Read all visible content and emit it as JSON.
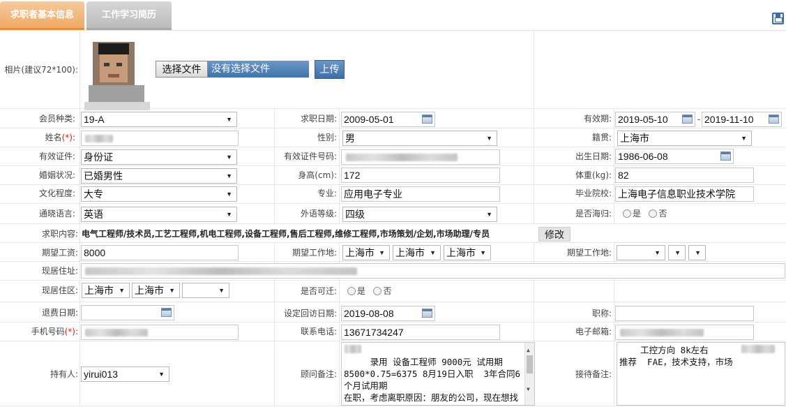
{
  "tabs": [
    {
      "label": "求职者基本信息",
      "active": true
    },
    {
      "label": "工作学习简历",
      "active": false
    }
  ],
  "photo": {
    "label": "相片(建议72*100):",
    "choose_file": "选择文件",
    "no_file": "没有选择文件",
    "upload": "上传"
  },
  "fields": {
    "member_type": {
      "label": "会员种类:",
      "value": "19-A"
    },
    "apply_date": {
      "label": "求职日期:",
      "value": "2009-05-01"
    },
    "valid_period": {
      "label": "有效期:",
      "from": "2019-05-10",
      "sep": "-",
      "to": "2019-11-10"
    },
    "name": {
      "label": "姓名",
      "req": "(*)",
      "colon": ":"
    },
    "gender": {
      "label": "性别:",
      "value": "男"
    },
    "native_place": {
      "label": "籍贯:",
      "value": "上海市"
    },
    "id_type": {
      "label": "有效证件:",
      "value": "身份证"
    },
    "id_number": {
      "label": "有效证件号码:"
    },
    "birth_date": {
      "label": "出生日期:",
      "value": "1986-06-08"
    },
    "marital": {
      "label": "婚姻状况:",
      "value": "已婚男性"
    },
    "height": {
      "label": "身高(cm):",
      "value": "172"
    },
    "weight": {
      "label": "体重(kg):",
      "value": "82"
    },
    "education": {
      "label": "文化程度:",
      "value": "大专"
    },
    "major": {
      "label": "专业:",
      "value": "应用电子专业"
    },
    "school": {
      "label": "毕业院校:",
      "value": "上海电子信息职业技术学院"
    },
    "language": {
      "label": "通晓语言:",
      "value": "英语"
    },
    "language_level": {
      "label": "外语等级:",
      "value": "四级"
    },
    "returnee": {
      "label": "是否海归:",
      "yes": "是",
      "no": "否"
    },
    "job_content": {
      "label": "求职内容:",
      "value": "电气工程师/技术员,工艺工程师,机电工程师,设备工程师,售后工程师,维修工程师,市场策划/企划,市场助理/专员",
      "modify": "修改"
    },
    "expected_salary": {
      "label": "期望工资:",
      "value": "8000"
    },
    "expected_location": {
      "label": "期望工作地:",
      "values": [
        "上海市",
        "上海市",
        "上海市"
      ]
    },
    "expected_location2": {
      "label": "期望工作地:"
    },
    "address": {
      "label": "现居住址:"
    },
    "district": {
      "label": "现居住区:",
      "values": [
        "上海市",
        "上海市",
        ""
      ]
    },
    "relocate": {
      "label": "是否可迁:",
      "yes": "是",
      "no": "否"
    },
    "refund_date": {
      "label": "退费日期:"
    },
    "revisit_date": {
      "label": "设定回访日期:",
      "value": "2019-08-08"
    },
    "title": {
      "label": "职称:"
    },
    "mobile": {
      "label": "手机号码",
      "req": "(*)",
      "colon": ":"
    },
    "phone": {
      "label": "联系电话:",
      "value": "13671734247"
    },
    "email": {
      "label": "电子邮箱:"
    },
    "owner": {
      "label": "持有人:",
      "value": "yirui013"
    },
    "consultant_note": {
      "label": "顾问备注:",
      "value": "   录用 设备工程师 9000元 试用期8500*0.75=6375 8月19日入职  3年合同6个月试用期\n在职，考虑离职原因：朋友的公司，现在想找份稳定的工作；"
    },
    "reception_note": {
      "label": "接待备注:",
      "value": "    工控方向 8k左右\n推荐  FAE，技术支持，市场"
    }
  },
  "colors": {
    "tab_active": "#eeaa64",
    "tab_inactive": "#bcbcbc",
    "button_blue": "#3f73ad"
  }
}
